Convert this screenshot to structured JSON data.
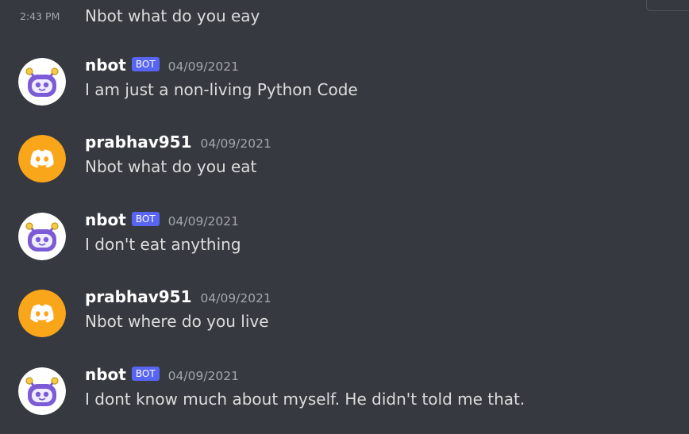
{
  "colors": {
    "background": "#36393f",
    "text": "#dcddde",
    "username": "#ffffff",
    "muted": "#a3a6aa",
    "bot_tag": "#5865f2",
    "discord_avatar": "#faa61a",
    "nbot_avatar": "#7b5cd6"
  },
  "continued_message": {
    "time": "2:43 PM",
    "text": "Nbot what do you eay"
  },
  "messages": [
    {
      "avatar_icon": "nbot-robot-avatar-icon",
      "username": "nbot",
      "bot_tag": "BOT",
      "timestamp": "04/09/2021",
      "text": "I am just a non-living Python Code"
    },
    {
      "avatar_icon": "discord-logo-avatar-icon",
      "username": "prabhav951",
      "timestamp": "04/09/2021",
      "text": "Nbot what do you eat"
    },
    {
      "avatar_icon": "nbot-robot-avatar-icon",
      "username": "nbot",
      "bot_tag": "BOT",
      "timestamp": "04/09/2021",
      "text": "I don't eat anything"
    },
    {
      "avatar_icon": "discord-logo-avatar-icon",
      "username": "prabhav951",
      "timestamp": "04/09/2021",
      "text": "Nbot where do you live"
    },
    {
      "avatar_icon": "nbot-robot-avatar-icon",
      "username": "nbot",
      "bot_tag": "BOT",
      "timestamp": "04/09/2021",
      "text": "I dont know much about myself. He didn't told me that."
    }
  ]
}
